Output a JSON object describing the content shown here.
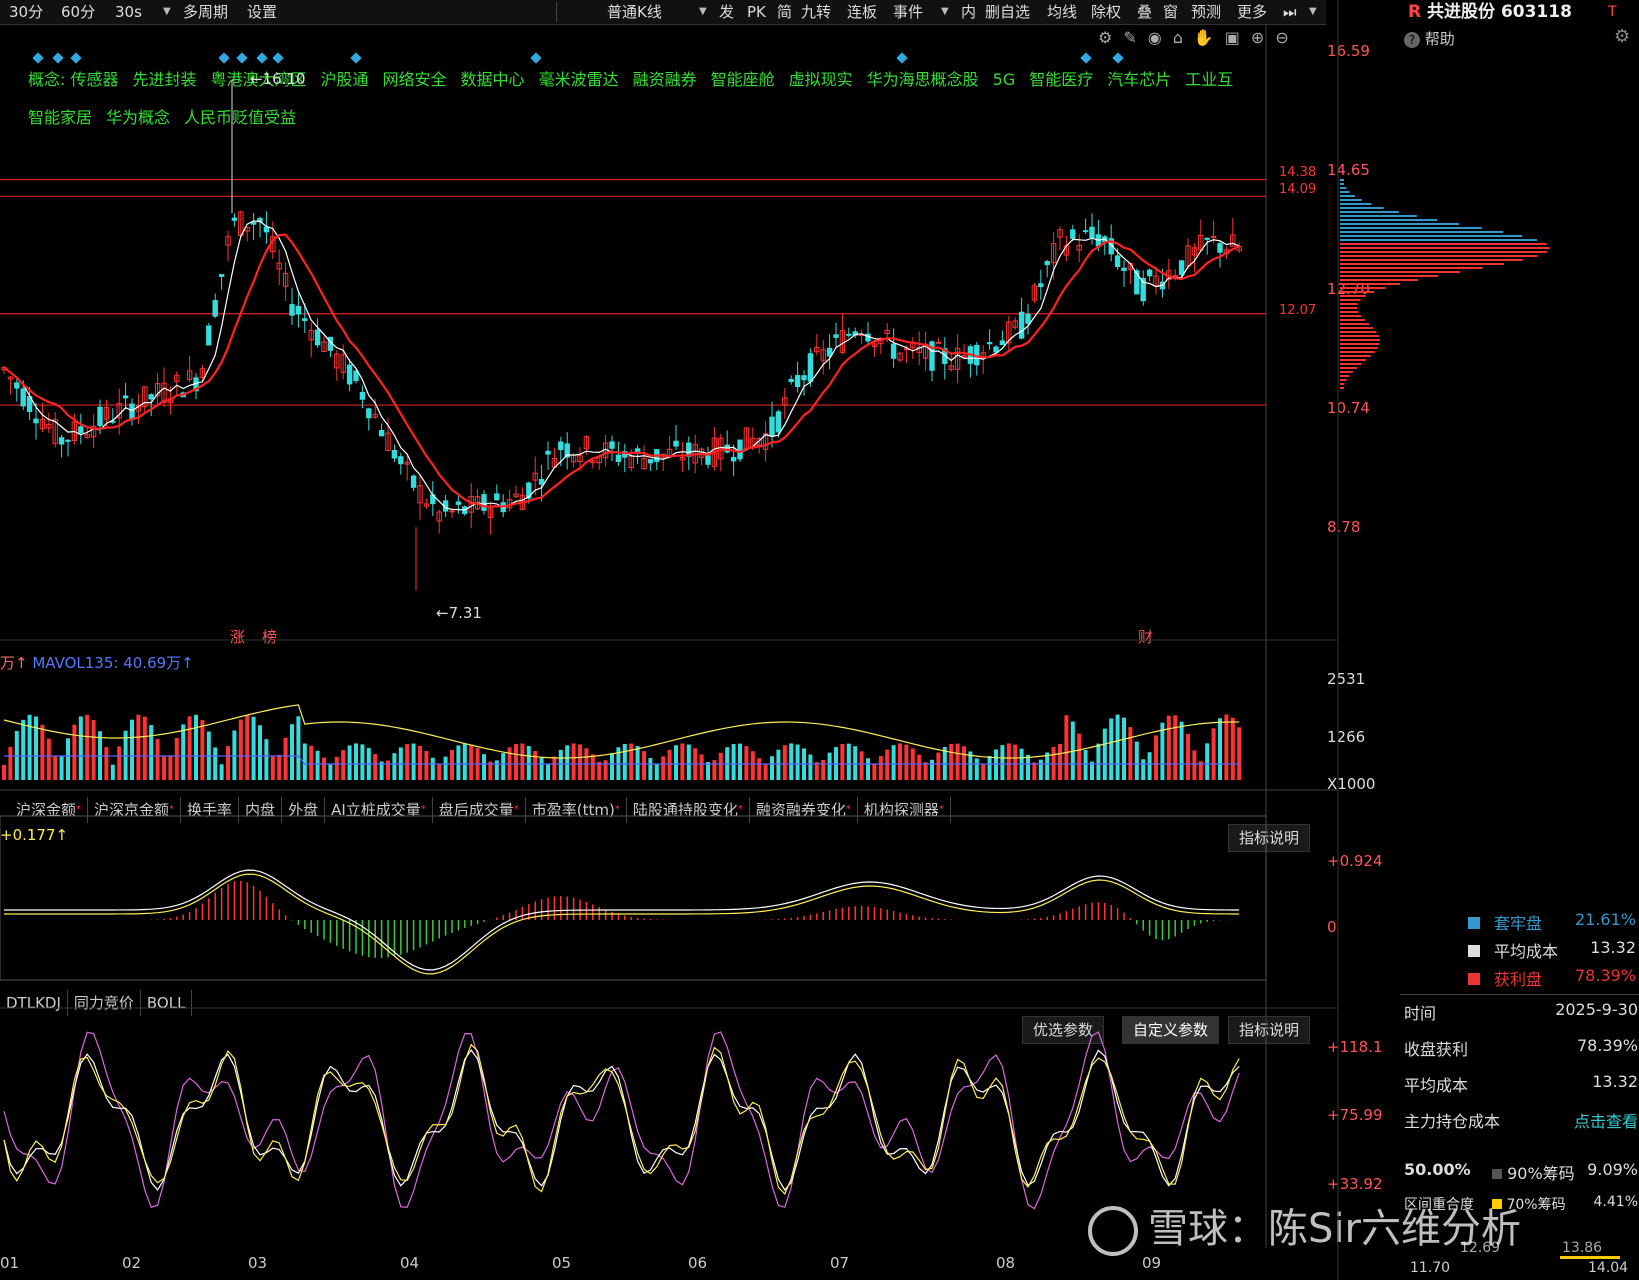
{
  "toolbar": {
    "items": [
      "30分",
      "60分",
      "30s",
      "多周期",
      "设置",
      "普通K线",
      "发",
      "PK",
      "简",
      "九转",
      "连板",
      "事件",
      "内",
      "删自选",
      "均线",
      "除权",
      "叠",
      "窗",
      "预测",
      "更多"
    ],
    "chart_type_label": "普通K线"
  },
  "stock": {
    "prefix": "R",
    "name": "共进股份",
    "code": "603118",
    "help": "帮助"
  },
  "concepts": {
    "line1": [
      "概念: 传感器",
      "先进封装",
      "粤港澳大湾区",
      "沪股通",
      "网络安全",
      "数据中心",
      "毫米波雷达",
      "融资融券",
      "智能座舱",
      "虚拟现实",
      "华为海思概念股",
      "5G",
      "智能医疗",
      "汽车芯片",
      "工业互"
    ],
    "line2": [
      "智能家居",
      "华为概念",
      "人民币贬值受益"
    ]
  },
  "price_axis": [
    "16.59",
    "14.65",
    "12.70",
    "10.74",
    "8.78"
  ],
  "price_lines": [
    {
      "label": "14.38",
      "value": 14.38
    },
    {
      "label": "14.09",
      "value": 14.09
    },
    {
      "label": "12.07",
      "value": 12.07
    }
  ],
  "price_annotations": {
    "high": "16.10",
    "low": "7.31",
    "marker_zhang": "涨",
    "marker_bang": "榜",
    "marker_cai": "财"
  },
  "volume": {
    "unit_prefix": "万↑",
    "mavol_label": "MAVOL135: 40.69万↑",
    "axis": [
      "2531",
      "1266",
      "X1000"
    ]
  },
  "indicator_tabs": [
    "沪深金额",
    "沪深京金额",
    "换手率",
    "内盘",
    "外盘",
    "AI立桩成交量",
    "盘后成交量",
    "市盈率(ttm)",
    "陆股通持股变化",
    "融资融券变化",
    "机构探测器"
  ],
  "macd": {
    "label": "+0.177↑",
    "axis": [
      "+0.924",
      "0"
    ],
    "explain_btn": "指标说明"
  },
  "kdj_tabs": [
    "DTLKDJ",
    "同力竞价",
    "BOLL"
  ],
  "kdj": {
    "buttons": [
      "优选参数",
      "自定义参数",
      "指标说明"
    ],
    "axis": [
      "+118.1",
      "+75.99",
      "+33.92"
    ]
  },
  "months": [
    "01",
    "02",
    "03",
    "04",
    "05",
    "06",
    "07",
    "08",
    "09"
  ],
  "chip": {
    "rows": [
      {
        "label": "套牢盘",
        "value": "21.61%",
        "color": "#3399cc"
      },
      {
        "label": "平均成本",
        "value": "13.32",
        "color": "#dddddd"
      },
      {
        "label": "获利盘",
        "value": "78.39%",
        "color": "#ee3333"
      }
    ],
    "detail": [
      {
        "label": "时间",
        "value": "2025-9-30"
      },
      {
        "label": "收盘获利",
        "value": "78.39%"
      },
      {
        "label": "平均成本",
        "value": "13.32"
      },
      {
        "label": "主力持仓成本",
        "value": "点击查看"
      }
    ],
    "concentration": {
      "pct": "50.00%",
      "c90_label": "90%筹码",
      "c90_value": "9.09%",
      "c70_label": "区间重合度",
      "c70_tag": "70%筹码",
      "c70_value": "4.41%"
    },
    "range": {
      "left": "11.70",
      "right": "14.04",
      "left2": "12.69",
      "right2": "13.86"
    }
  },
  "watermark": "雪球：陈Sir六维分析",
  "colors": {
    "up": "#ff3333",
    "down": "#33dddd",
    "ma_short": "#ffffff",
    "ma_long": "#ff2222",
    "concept": "#33dd33"
  }
}
